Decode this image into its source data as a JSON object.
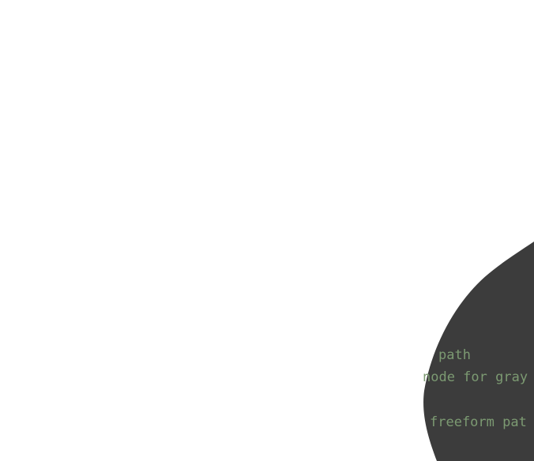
{
  "colors": {
    "background": "#ffffff",
    "panel": "#3c3c3c",
    "code_text": "#7c9a72"
  },
  "code_lines": [
    {
      "text": "path"
    },
    {
      "text": "node for gray"
    },
    {
      "text": "freeform pat"
    }
  ]
}
